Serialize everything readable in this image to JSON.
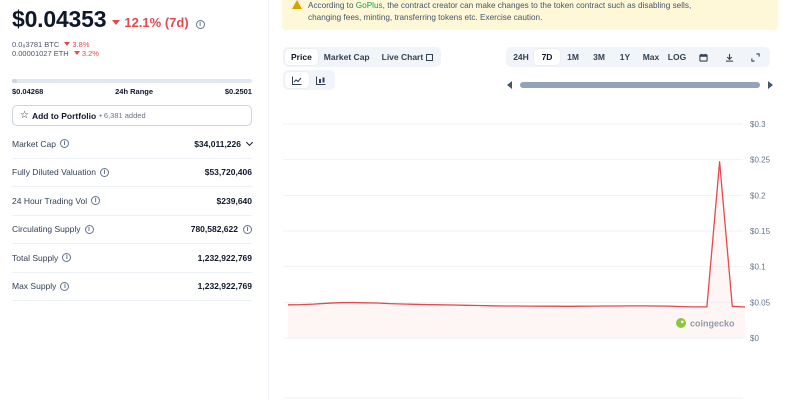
{
  "coin": {
    "price": "$0.04353",
    "change_7d": "12.1% (7d)",
    "btc_price": "0.0₈3781 BTC",
    "btc_change": "3.8%",
    "eth_price": "0.00001027 ETH",
    "eth_change": "3.2%"
  },
  "range": {
    "low": "$0.04268",
    "label": "24h Range",
    "high": "$0.2501",
    "position_fraction": 0.02
  },
  "portfolio": {
    "label": "Add to Portfolio",
    "added": "6,381 added"
  },
  "stats": [
    {
      "label": "Market Cap",
      "value": "$34,011,226"
    },
    {
      "label": "Fully Diluted Valuation",
      "value": "$53,720,406"
    },
    {
      "label": "24 Hour Trading Vol",
      "value": "$239,640"
    },
    {
      "label": "Circulating Supply",
      "value": "780,582,622"
    },
    {
      "label": "Total Supply",
      "value": "1,232,922,769"
    },
    {
      "label": "Max Supply",
      "value": "1,232,922,769"
    }
  ],
  "warning": {
    "prefix": "According to ",
    "link": "GoPlus",
    "line1_rest": ", the contract creator can make changes to the token contract such as disabling sells,",
    "line2": "changing fees, minting, transferring tokens etc. Exercise caution."
  },
  "chart_tabs": [
    "Price",
    "Market Cap",
    "Live Chart"
  ],
  "range_tabs": [
    "24H",
    "7D",
    "1M",
    "3M",
    "1Y",
    "Max",
    "LOG"
  ],
  "active_chart_tab": "Price",
  "active_range_tab": "7D",
  "watermark": "coingecko",
  "colors": {
    "line": "#e5484d",
    "fill": "#fde2e2",
    "accent_green": "#8dc63f"
  },
  "chart_data": {
    "type": "area",
    "title": "",
    "xlabel": "",
    "ylabel": "",
    "ylim": [
      0,
      0.3
    ],
    "y_ticks": [
      "$0.3",
      "$0.25",
      "$0.2",
      "$0.15",
      "$0.1",
      "$0.05",
      "$0"
    ],
    "y_tick_values": [
      0.3,
      0.25,
      0.2,
      0.15,
      0.1,
      0.05,
      0
    ],
    "grid": true,
    "series": [
      {
        "values": [
          0.0465,
          0.0468,
          0.0475,
          0.0487,
          0.0495,
          0.0497,
          0.0493,
          0.049,
          0.0482,
          0.0476,
          0.0472,
          0.0468,
          0.0465,
          0.0462,
          0.0458,
          0.0455,
          0.0452,
          0.0449,
          0.0448,
          0.0447,
          0.0446,
          0.0446,
          0.0445,
          0.0446,
          0.0447,
          0.0448,
          0.0449,
          0.045,
          0.045,
          0.0449,
          0.0447,
          0.044,
          0.0436,
          0.0438,
          0.247,
          0.0445,
          0.0435
        ]
      }
    ]
  }
}
